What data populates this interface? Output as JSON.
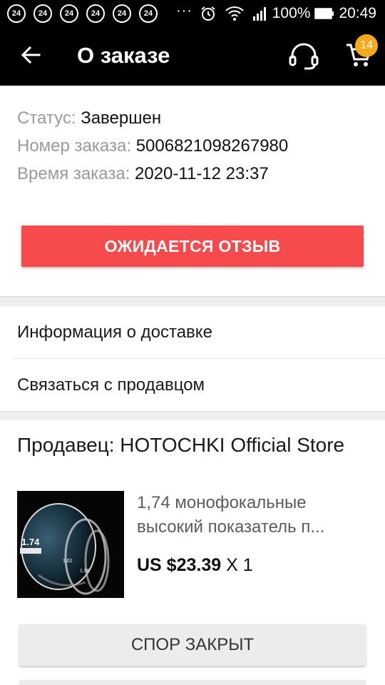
{
  "statusbar": {
    "notifications": [
      "24",
      "24",
      "24",
      "24",
      "24",
      "24"
    ],
    "overflow": "···",
    "battery": "100%",
    "time": "20:49"
  },
  "appbar": {
    "title": "О заказе",
    "cart_count": "14",
    "badge_color": "#f7a81b"
  },
  "order": {
    "status_label": "Статус: ",
    "status_value": "Завершен",
    "number_label": "Номер заказа: ",
    "number_value": "5006821098267980",
    "time_label": "Время заказа: ",
    "time_value": "2020-11-12 23:37"
  },
  "actions": {
    "review_label": "ОЖИДАЕТСЯ ОТЗЫВ",
    "review_color": "#f64a4d",
    "dispute_label": "СПОР ЗАКРЫТ"
  },
  "links": {
    "delivery": "Информация о доставке",
    "contact_seller": "Связаться с продавцом"
  },
  "seller": {
    "label": "Продавец: HOTOCHKI Official Store"
  },
  "product": {
    "name_line1": "1,74 монофокальные",
    "name_line2": "высокий показатель п...",
    "price": "US $23.39",
    "quantity": " X 1",
    "image_labels": {
      "index_main": "1.74",
      "index_a": "1.61",
      "index_b": "1.56"
    }
  }
}
